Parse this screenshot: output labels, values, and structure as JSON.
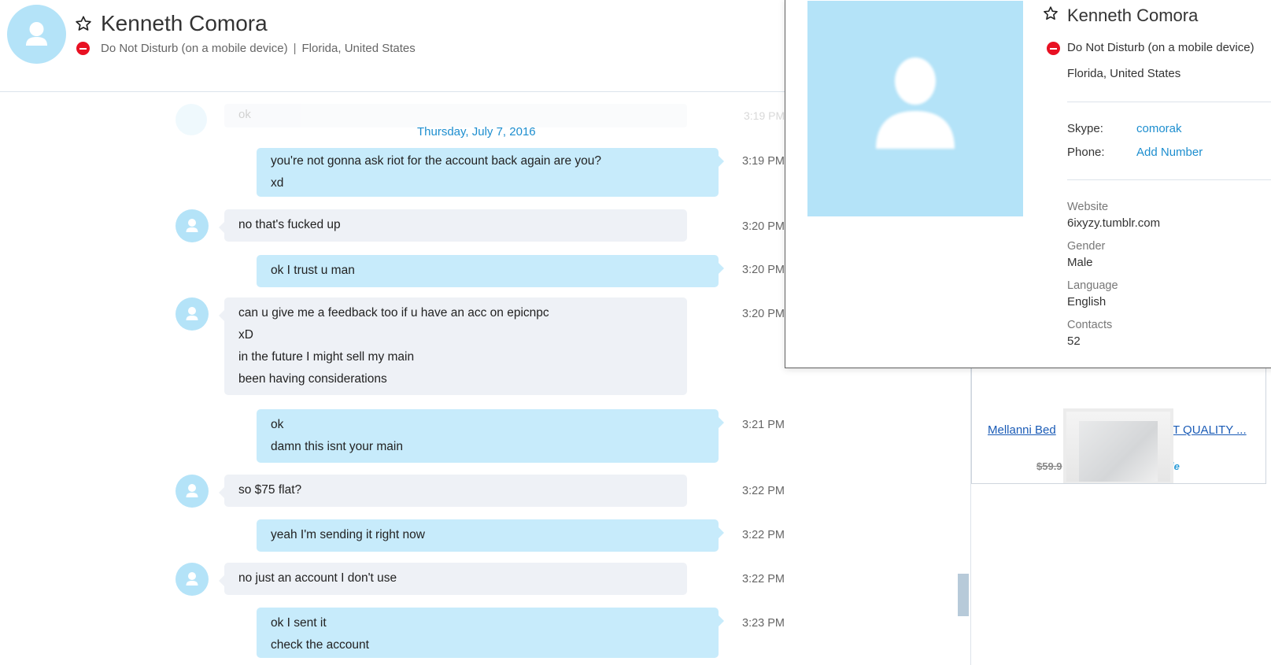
{
  "header": {
    "name": "Kenneth Comora",
    "status": "Do Not Disturb (on a mobile device)",
    "separator": "|",
    "location": "Florida, United States"
  },
  "chat": {
    "faded_message": "ok",
    "faded_time": "3:19 PM",
    "date_separator": "Thursday, July 7, 2016",
    "messages": [
      {
        "direction": "out",
        "lines": [
          "you're not gonna ask riot for the account back again are you?",
          "xd"
        ],
        "time": "3:19 PM"
      },
      {
        "direction": "in",
        "lines": [
          "no that's fucked up"
        ],
        "time": "3:20 PM"
      },
      {
        "direction": "out",
        "lines": [
          "ok I trust u man"
        ],
        "time": "3:20 PM"
      },
      {
        "direction": "in",
        "lines": [
          "can u give me a feedback too if u have an acc on epicnpc",
          "xD",
          "in the future I might sell my main",
          "been having considerations"
        ],
        "time": "3:20 PM"
      },
      {
        "direction": "out",
        "lines": [
          "ok",
          "damn this isnt your main"
        ],
        "time": "3:21 PM"
      },
      {
        "direction": "in",
        "lines": [
          "so $75 flat?"
        ],
        "time": "3:22 PM"
      },
      {
        "direction": "out",
        "lines": [
          "yeah I'm sending it right now"
        ],
        "time": "3:22 PM"
      },
      {
        "direction": "in",
        "lines": [
          "no just an account I don't use"
        ],
        "time": "3:22 PM"
      },
      {
        "direction": "out",
        "lines": [
          "ok I sent it",
          "check the account"
        ],
        "time": "3:23 PM"
      }
    ]
  },
  "profile": {
    "name": "Kenneth Comora",
    "status": "Do Not Disturb (on a mobile device)",
    "location": "Florida, United States",
    "skype_label": "Skype:",
    "skype_value": "comorak",
    "phone_label": "Phone:",
    "phone_value": "Add Number",
    "website_label": "Website",
    "website_value": "6ixyzy.tumblr.com",
    "gender_label": "Gender",
    "gender_value": "Male",
    "language_label": "Language",
    "language_value": "English",
    "contacts_label": "Contacts",
    "contacts_value": "52"
  },
  "ad": {
    "link_left": "Mellanni Bed",
    "link_right": "T QUALITY ...",
    "price": "$59.9",
    "brand": "ie"
  },
  "colors": {
    "accent": "#1d8ecf",
    "outgoing_bubble": "#c7ebfb",
    "incoming_bubble": "#eef1f6",
    "avatar": "#b4e3f8",
    "dnd": "#e81123"
  },
  "icons": {
    "favorite": "star-outline-icon",
    "status": "do-not-disturb-icon",
    "avatar": "person-silhouette-icon"
  }
}
